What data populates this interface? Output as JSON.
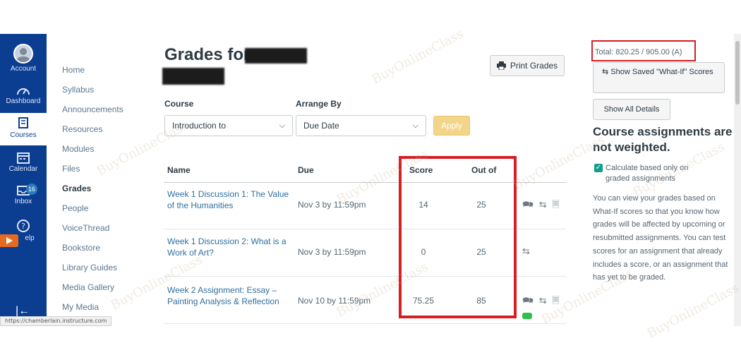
{
  "global_nav": {
    "items": [
      {
        "label": "Account",
        "icon": "account-avatar-icon"
      },
      {
        "label": "Dashboard",
        "icon": "dashboard-icon"
      },
      {
        "label": "Courses",
        "icon": "courses-icon"
      },
      {
        "label": "Calendar",
        "icon": "calendar-icon"
      },
      {
        "label": "Inbox",
        "icon": "inbox-icon",
        "badge": "16"
      },
      {
        "label": "elp",
        "icon": "help-icon"
      }
    ],
    "active": "Courses",
    "collapse_glyph": "|←"
  },
  "status_url": "https://chamberlain.instructure.com",
  "course_nav": {
    "items": [
      "Home",
      "Syllabus",
      "Announcements",
      "Resources",
      "Modules",
      "Files",
      "Grades",
      "People",
      "VoiceThread",
      "Bookstore",
      "Library Guides",
      "Media Gallery",
      "My Media"
    ],
    "active": "Grades"
  },
  "header": {
    "title": "Grades for",
    "print_label": "Print Grades"
  },
  "filters": {
    "course_label": "Course",
    "course_value": "Introduction to",
    "arrange_label": "Arrange By",
    "arrange_value": "Due Date",
    "apply_label": "Apply"
  },
  "table": {
    "headers": {
      "name": "Name",
      "due": "Due",
      "score": "Score",
      "out_of": "Out of"
    },
    "rows": [
      {
        "name": "Week 1 Discussion 1: The Value of the Humanities",
        "due": "Nov 3 by 11:59pm",
        "score": "14",
        "out_of": "25",
        "icons": "🗪 ⇆ 🗏"
      },
      {
        "name": "Week 1 Discussion 2: What is a Work of Art?",
        "due": "Nov 3 by 11:59pm",
        "score": "0",
        "out_of": "25",
        "icons": "⇆"
      },
      {
        "name": "Week 2 Assignment: Essay – Painting Analysis & Reflection",
        "due": "Nov 10 by 11:59pm",
        "score": "75.25",
        "out_of": "85",
        "icons": "🗪 ⇆ 🗏"
      }
    ]
  },
  "sidebar": {
    "total": "Total: 820.25 / 905.00 (A)",
    "what_if_button": "Show Saved \"What-If\" Scores",
    "details_button": "Show All Details",
    "weight_heading": "Course assignments are not weighted.",
    "calc_label": "Calculate based only on graded assignments",
    "info": "You can view your grades based on What-If scores so that you know how grades will be affected by upcoming or resubmitted assignments. You can test scores for an assignment that already includes a score, or an assignment that has yet to be graded."
  },
  "watermark": "BuyOnlineClass",
  "colors": {
    "nav_bg": "#0b3d91",
    "highlight": "#d61e23",
    "link": "#2f6f9f",
    "apply": "#f3d58a",
    "check": "#129f8a"
  }
}
